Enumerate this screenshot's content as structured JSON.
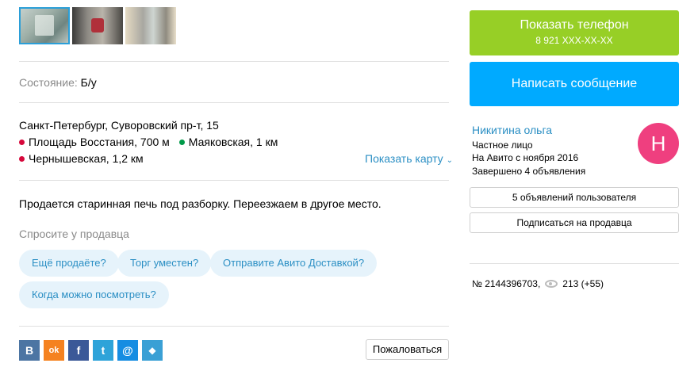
{
  "condition": {
    "label": "Состояние:",
    "value": "Б/у"
  },
  "location": {
    "address": "Санкт-Петербург, Суворовский пр-т, 15",
    "metro": [
      {
        "name": "Площадь Восстания, 700 м",
        "color": "#d6083b"
      },
      {
        "name": "Маяковская, 1 км",
        "color": "#009a49"
      },
      {
        "name": "Чернышевская, 1,2 км",
        "color": "#d6083b"
      }
    ],
    "map_link": "Показать карту"
  },
  "description": "Продается старинная печь под разборку. Переезжаем в другое место.",
  "ask_seller": {
    "title": "Спросите у продавца",
    "chips": [
      "Ещё продаёте?",
      "Торг уместен?",
      "Отправите Авито Доставкой?",
      "Когда можно посмотреть?"
    ]
  },
  "share": {
    "buttons": [
      {
        "label": "B",
        "color": "#4c75a3"
      },
      {
        "label": "ok",
        "color": "#f58220"
      },
      {
        "label": "f",
        "color": "#3b5998"
      },
      {
        "label": "t",
        "color": "#2ea3d9"
      },
      {
        "label": "@",
        "color": "#168de2"
      },
      {
        "label": "◆",
        "color": "#3aa0d5"
      }
    ],
    "report_label": "Пожаловаться"
  },
  "actions": {
    "phone_label": "Показать телефон",
    "phone_number": "8 921 XXX-XX-XX",
    "message_label": "Написать сообщение"
  },
  "seller": {
    "name": "Никитина ольга",
    "type": "Частное лицо",
    "since": "На Авито с ноября 2016",
    "completed": "Завершено 4 объявления",
    "avatar_letter": "Н",
    "ads_button": "5 объявлений пользователя",
    "subscribe_button": "Подписаться на продавца"
  },
  "stats": {
    "ad_number": "№ 2144396703,",
    "views": "213 (+55)"
  },
  "colors": {
    "green": "#97cf26",
    "blue": "#00aaff",
    "link": "#2b8fc4",
    "avatar": "#ef3f7f"
  }
}
